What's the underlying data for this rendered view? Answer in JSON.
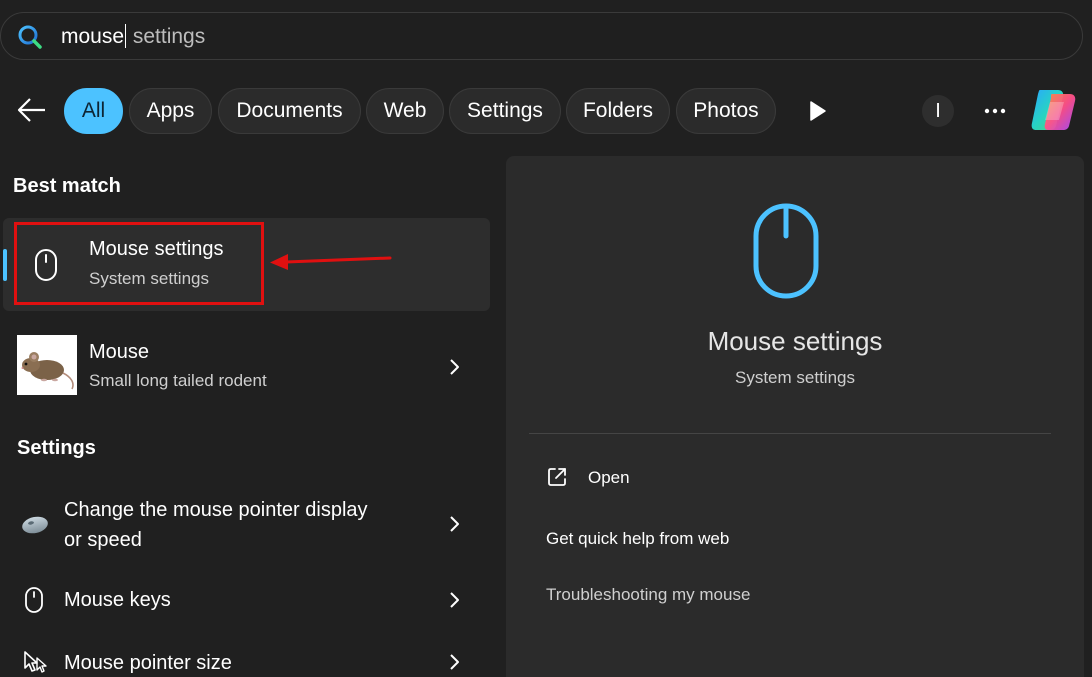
{
  "search": {
    "typed": "mouse",
    "suggestion": " settings"
  },
  "filters": {
    "items": [
      {
        "label": "All",
        "active": true
      },
      {
        "label": "Apps"
      },
      {
        "label": "Documents"
      },
      {
        "label": "Web"
      },
      {
        "label": "Settings"
      },
      {
        "label": "Folders"
      },
      {
        "label": "Photos"
      }
    ],
    "profile_initial": "I"
  },
  "best_match": {
    "heading": "Best match",
    "title": "Mouse settings",
    "subtitle": "System settings",
    "icon": "mouse-icon"
  },
  "web_result": {
    "title": "Mouse",
    "subtitle": "Small long tailed rodent",
    "icon": "mouse-photo"
  },
  "settings": {
    "heading": "Settings",
    "items": [
      {
        "line1": "Change the mouse pointer display",
        "line2": "or speed",
        "icon": "mouse-device-icon"
      },
      {
        "line1": "Mouse keys",
        "icon": "mouse-icon"
      },
      {
        "line1": "Mouse pointer size",
        "icon": "pointer-size-icon"
      }
    ]
  },
  "preview": {
    "title": "Mouse settings",
    "subtitle": "System settings",
    "icon": "mouse-icon",
    "actions": [
      {
        "label": "Open",
        "icon": "open-external-icon"
      },
      {
        "label": "Get quick help from web"
      },
      {
        "label": "Troubleshooting my mouse"
      }
    ]
  },
  "colors": {
    "accent": "#4cc2ff",
    "background": "#202020",
    "panel": "#2b2b2b",
    "annotation": "#e01010"
  }
}
